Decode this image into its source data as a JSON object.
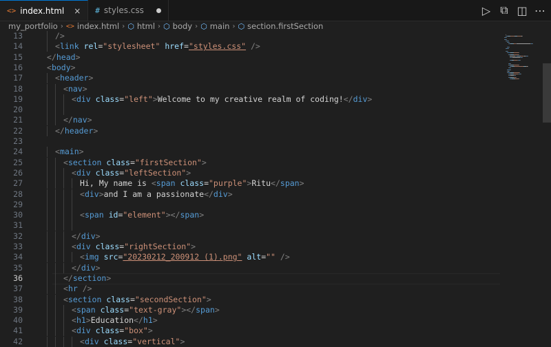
{
  "tabs": [
    {
      "label": "index.html",
      "icon": "html-file-icon",
      "icon_glyph": "<>",
      "active": true,
      "close_glyph": "×"
    },
    {
      "label": "styles.css",
      "icon": "css-file-icon",
      "icon_glyph": "#",
      "active": false,
      "modified": true
    }
  ],
  "actions": [
    {
      "name": "run-icon",
      "glyph": "▷"
    },
    {
      "name": "open-preview-icon",
      "glyph": "⧉"
    },
    {
      "name": "split-editor-icon",
      "glyph": "◫"
    },
    {
      "name": "more-actions-icon",
      "glyph": "⋯"
    }
  ],
  "breadcrumb": {
    "items": [
      "my_portfolio",
      "index.html",
      "html",
      "body",
      "main",
      "section.firstSection"
    ]
  },
  "editor": {
    "current_line": 36,
    "lines": [
      {
        "n": 13,
        "indent": 1,
        "tokens": [
          [
            "punc",
            "/>"
          ]
        ]
      },
      {
        "n": 14,
        "indent": 1,
        "tokens": [
          [
            "punc",
            "<"
          ],
          [
            "tag",
            "link"
          ],
          [
            "txt",
            " "
          ],
          [
            "attr",
            "rel"
          ],
          [
            "txt",
            "="
          ],
          [
            "str",
            "\"stylesheet\""
          ],
          [
            "txt",
            " "
          ],
          [
            "attr",
            "href"
          ],
          [
            "txt",
            "="
          ],
          [
            "str",
            "\"styles.css\"",
            "link"
          ],
          [
            "txt",
            " "
          ],
          [
            "punc",
            "/>"
          ]
        ]
      },
      {
        "n": 15,
        "indent": 0,
        "tokens": [
          [
            "punc",
            "</"
          ],
          [
            "tag",
            "head"
          ],
          [
            "punc",
            ">"
          ]
        ]
      },
      {
        "n": 16,
        "indent": 0,
        "tokens": [
          [
            "punc",
            "<"
          ],
          [
            "tag",
            "body"
          ],
          [
            "punc",
            ">"
          ]
        ]
      },
      {
        "n": 17,
        "indent": 1,
        "tokens": [
          [
            "punc",
            "<"
          ],
          [
            "tag",
            "header"
          ],
          [
            "punc",
            ">"
          ]
        ]
      },
      {
        "n": 18,
        "indent": 2,
        "tokens": [
          [
            "punc",
            "<"
          ],
          [
            "tag",
            "nav"
          ],
          [
            "punc",
            ">"
          ]
        ]
      },
      {
        "n": 19,
        "indent": 3,
        "tokens": [
          [
            "punc",
            "<"
          ],
          [
            "tag",
            "div"
          ],
          [
            "txt",
            " "
          ],
          [
            "attr",
            "class"
          ],
          [
            "txt",
            "="
          ],
          [
            "str",
            "\"left\""
          ],
          [
            "punc",
            ">"
          ],
          [
            "txt",
            "Welcome to my creative realm of coding!"
          ],
          [
            "punc",
            "</"
          ],
          [
            "tag",
            "div"
          ],
          [
            "punc",
            ">"
          ]
        ]
      },
      {
        "n": 20,
        "indent": 3,
        "tokens": []
      },
      {
        "n": 21,
        "indent": 2,
        "tokens": [
          [
            "punc",
            "</"
          ],
          [
            "tag",
            "nav"
          ],
          [
            "punc",
            ">"
          ]
        ]
      },
      {
        "n": 22,
        "indent": 1,
        "tokens": [
          [
            "punc",
            "</"
          ],
          [
            "tag",
            "header"
          ],
          [
            "punc",
            ">"
          ]
        ]
      },
      {
        "n": 23,
        "indent": 0,
        "tokens": []
      },
      {
        "n": 24,
        "indent": 1,
        "tokens": [
          [
            "punc",
            "<"
          ],
          [
            "tag",
            "main"
          ],
          [
            "punc",
            ">"
          ]
        ]
      },
      {
        "n": 25,
        "indent": 2,
        "tokens": [
          [
            "punc",
            "<"
          ],
          [
            "tag",
            "section"
          ],
          [
            "txt",
            " "
          ],
          [
            "attr",
            "class"
          ],
          [
            "txt",
            "="
          ],
          [
            "str",
            "\"firstSection\""
          ],
          [
            "punc",
            ">"
          ]
        ]
      },
      {
        "n": 26,
        "indent": 3,
        "tokens": [
          [
            "punc",
            "<"
          ],
          [
            "tag",
            "div"
          ],
          [
            "txt",
            " "
          ],
          [
            "attr",
            "class"
          ],
          [
            "txt",
            "="
          ],
          [
            "str",
            "\"leftSection\""
          ],
          [
            "punc",
            ">"
          ]
        ]
      },
      {
        "n": 27,
        "indent": 4,
        "tokens": [
          [
            "txt",
            "Hi, My name is "
          ],
          [
            "punc",
            "<"
          ],
          [
            "tag",
            "span"
          ],
          [
            "txt",
            " "
          ],
          [
            "attr",
            "class"
          ],
          [
            "txt",
            "="
          ],
          [
            "str",
            "\"purple\""
          ],
          [
            "punc",
            ">"
          ],
          [
            "txt",
            "Ritu"
          ],
          [
            "punc",
            "</"
          ],
          [
            "tag",
            "span"
          ],
          [
            "punc",
            ">"
          ]
        ]
      },
      {
        "n": 28,
        "indent": 4,
        "tokens": [
          [
            "punc",
            "<"
          ],
          [
            "tag",
            "div"
          ],
          [
            "punc",
            ">"
          ],
          [
            "txt",
            "and I am a passionate"
          ],
          [
            "punc",
            "</"
          ],
          [
            "tag",
            "div"
          ],
          [
            "punc",
            ">"
          ]
        ]
      },
      {
        "n": 29,
        "indent": 4,
        "tokens": []
      },
      {
        "n": 30,
        "indent": 4,
        "tokens": [
          [
            "punc",
            "<"
          ],
          [
            "tag",
            "span"
          ],
          [
            "txt",
            " "
          ],
          [
            "attr",
            "id"
          ],
          [
            "txt",
            "="
          ],
          [
            "str",
            "\"element\""
          ],
          [
            "punc",
            ">"
          ],
          [
            "punc",
            "</"
          ],
          [
            "tag",
            "span"
          ],
          [
            "punc",
            ">"
          ]
        ]
      },
      {
        "n": 31,
        "indent": 4,
        "tokens": []
      },
      {
        "n": 32,
        "indent": 3,
        "tokens": [
          [
            "punc",
            "</"
          ],
          [
            "tag",
            "div"
          ],
          [
            "punc",
            ">"
          ]
        ]
      },
      {
        "n": 33,
        "indent": 3,
        "tokens": [
          [
            "punc",
            "<"
          ],
          [
            "tag",
            "div"
          ],
          [
            "txt",
            " "
          ],
          [
            "attr",
            "class"
          ],
          [
            "txt",
            "="
          ],
          [
            "str",
            "\"rightSection\""
          ],
          [
            "punc",
            ">"
          ]
        ]
      },
      {
        "n": 34,
        "indent": 4,
        "tokens": [
          [
            "punc",
            "<"
          ],
          [
            "tag",
            "img"
          ],
          [
            "txt",
            " "
          ],
          [
            "attr",
            "src"
          ],
          [
            "txt",
            "="
          ],
          [
            "str",
            "\"20230212_200912 (1).png\"",
            "link"
          ],
          [
            "txt",
            " "
          ],
          [
            "attr",
            "alt"
          ],
          [
            "txt",
            "="
          ],
          [
            "str",
            "\"\""
          ],
          [
            "txt",
            " "
          ],
          [
            "punc",
            "/>"
          ]
        ]
      },
      {
        "n": 35,
        "indent": 3,
        "tokens": [
          [
            "punc",
            "</"
          ],
          [
            "tag",
            "div"
          ],
          [
            "punc",
            ">"
          ]
        ]
      },
      {
        "n": 36,
        "indent": 2,
        "tokens": [
          [
            "punc",
            "</"
          ],
          [
            "tag",
            "section"
          ],
          [
            "punc",
            ">"
          ]
        ]
      },
      {
        "n": 37,
        "indent": 2,
        "tokens": [
          [
            "punc",
            "<"
          ],
          [
            "tag",
            "hr"
          ],
          [
            "txt",
            " "
          ],
          [
            "punc",
            "/>"
          ]
        ]
      },
      {
        "n": 38,
        "indent": 2,
        "tokens": [
          [
            "punc",
            "<"
          ],
          [
            "tag",
            "section"
          ],
          [
            "txt",
            " "
          ],
          [
            "attr",
            "class"
          ],
          [
            "txt",
            "="
          ],
          [
            "str",
            "\"secondSection\""
          ],
          [
            "punc",
            ">"
          ]
        ]
      },
      {
        "n": 39,
        "indent": 3,
        "tokens": [
          [
            "punc",
            "<"
          ],
          [
            "tag",
            "span"
          ],
          [
            "txt",
            " "
          ],
          [
            "attr",
            "class"
          ],
          [
            "txt",
            "="
          ],
          [
            "str",
            "\"text-gray\""
          ],
          [
            "punc",
            ">"
          ],
          [
            "punc",
            "</"
          ],
          [
            "tag",
            "span"
          ],
          [
            "punc",
            ">"
          ]
        ]
      },
      {
        "n": 40,
        "indent": 3,
        "tokens": [
          [
            "punc",
            "<"
          ],
          [
            "tag",
            "h1"
          ],
          [
            "punc",
            ">"
          ],
          [
            "txt",
            "Education"
          ],
          [
            "punc",
            "</"
          ],
          [
            "tag",
            "h1"
          ],
          [
            "punc",
            ">"
          ]
        ]
      },
      {
        "n": 41,
        "indent": 3,
        "tokens": [
          [
            "punc",
            "<"
          ],
          [
            "tag",
            "div"
          ],
          [
            "txt",
            " "
          ],
          [
            "attr",
            "class"
          ],
          [
            "txt",
            "="
          ],
          [
            "str",
            "\"box\""
          ],
          [
            "punc",
            ">"
          ]
        ]
      },
      {
        "n": 42,
        "indent": 4,
        "tokens": [
          [
            "punc",
            "<"
          ],
          [
            "tag",
            "div"
          ],
          [
            "txt",
            " "
          ],
          [
            "attr",
            "class"
          ],
          [
            "txt",
            "="
          ],
          [
            "str",
            "\"vertical\""
          ],
          [
            "punc",
            ">"
          ]
        ]
      }
    ]
  },
  "colors": {
    "tag": "#569cd6",
    "attr": "#9cdcfe",
    "string": "#ce9178",
    "text": "#d4d4d4",
    "punctuation": "#808080",
    "line_number": "#6e7681",
    "background": "#1f1f1f",
    "accent": "#0078d4"
  }
}
